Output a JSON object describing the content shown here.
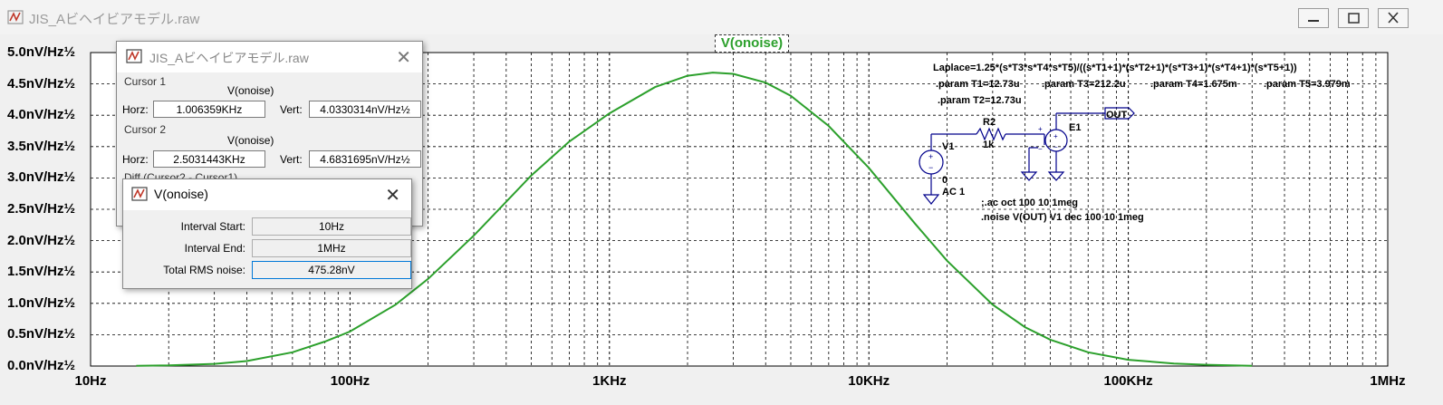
{
  "window": {
    "title": "JIS_Aビヘイビアモデル.raw"
  },
  "plot": {
    "title": "V(onoise)",
    "trace_color": "#2ca02c"
  },
  "chart_data": {
    "type": "line",
    "x_scale": "log",
    "xlim": [
      10,
      1000000
    ],
    "ylim": [
      0,
      5.0
    ],
    "x_ticks": [
      "10Hz",
      "100Hz",
      "1KHz",
      "10KHz",
      "100KHz",
      "1MHz"
    ],
    "y_ticks": [
      "0.0nV/Hz½",
      "0.5nV/Hz½",
      "1.0nV/Hz½",
      "1.5nV/Hz½",
      "2.0nV/Hz½",
      "2.5nV/Hz½",
      "3.0nV/Hz½",
      "3.5nV/Hz½",
      "4.0nV/Hz½",
      "4.5nV/Hz½",
      "5.0nV/Hz½"
    ],
    "grid": true,
    "series": [
      {
        "name": "V(onoise)",
        "x": [
          15,
          20,
          30,
          40,
          60,
          80,
          100,
          150,
          200,
          300,
          400,
          500,
          700,
          1000,
          1500,
          2000,
          2500,
          3000,
          4000,
          5000,
          7000,
          10000,
          15000,
          20000,
          30000,
          40000,
          50000,
          70000,
          100000,
          150000,
          200000,
          300000
        ],
        "y": [
          0.004,
          0.01,
          0.035,
          0.08,
          0.22,
          0.39,
          0.55,
          0.98,
          1.39,
          2.08,
          2.62,
          3.04,
          3.58,
          4.03,
          4.45,
          4.63,
          4.68,
          4.66,
          4.52,
          4.31,
          3.83,
          3.16,
          2.28,
          1.68,
          0.98,
          0.62,
          0.42,
          0.22,
          0.1,
          0.04,
          0.02,
          0.005
        ]
      }
    ]
  },
  "schematic": {
    "laplace": "Laplace=1.25*(s*T3*s*T4*s*T5)/((s*T1+1)*(s*T2+1)*(s*T3+1)*(s*T4+1)*(s*T5+1))",
    "params": [
      ".param T1=12.73u",
      ".param T3=212.2u",
      ".param T4=1.675m",
      ".param T5=3.979m"
    ],
    "param_t2": ".param T2=12.73u",
    "r2_name": "R2",
    "r2_value": "1k",
    "e1_name": "E1",
    "out_label": "OUT",
    "v1_name": "V1",
    "v1_dc": "0",
    "v1_ac": "AC 1",
    "directive1": ";.ac oct 100 10 1meg",
    "directive2": ".noise V(OUT) V1 dec 100 10 1meg"
  },
  "cursor_dialog": {
    "title": "JIS_Aビヘイビアモデル.raw",
    "cursor1_label": "Cursor 1",
    "cursor1_trace": "V(onoise)",
    "cursor1_horz": "1.006359KHz",
    "cursor1_vert": "4.0330314nV/Hz½",
    "cursor2_label": "Cursor 2",
    "cursor2_trace": "V(onoise)",
    "cursor2_horz": "2.5031443KHz",
    "cursor2_vert": "4.6831695nV/Hz½",
    "horz_label": "Horz:",
    "vert_label": "Vert:",
    "diff_label": "Diff (Cursor2 - Cursor1)"
  },
  "noise_dialog": {
    "title": "V(onoise)",
    "interval_start_label": "Interval Start:",
    "interval_start": "10Hz",
    "interval_end_label": "Interval End:",
    "interval_end": "1MHz",
    "total_label": "Total RMS noise:",
    "total": "475.28nV"
  }
}
